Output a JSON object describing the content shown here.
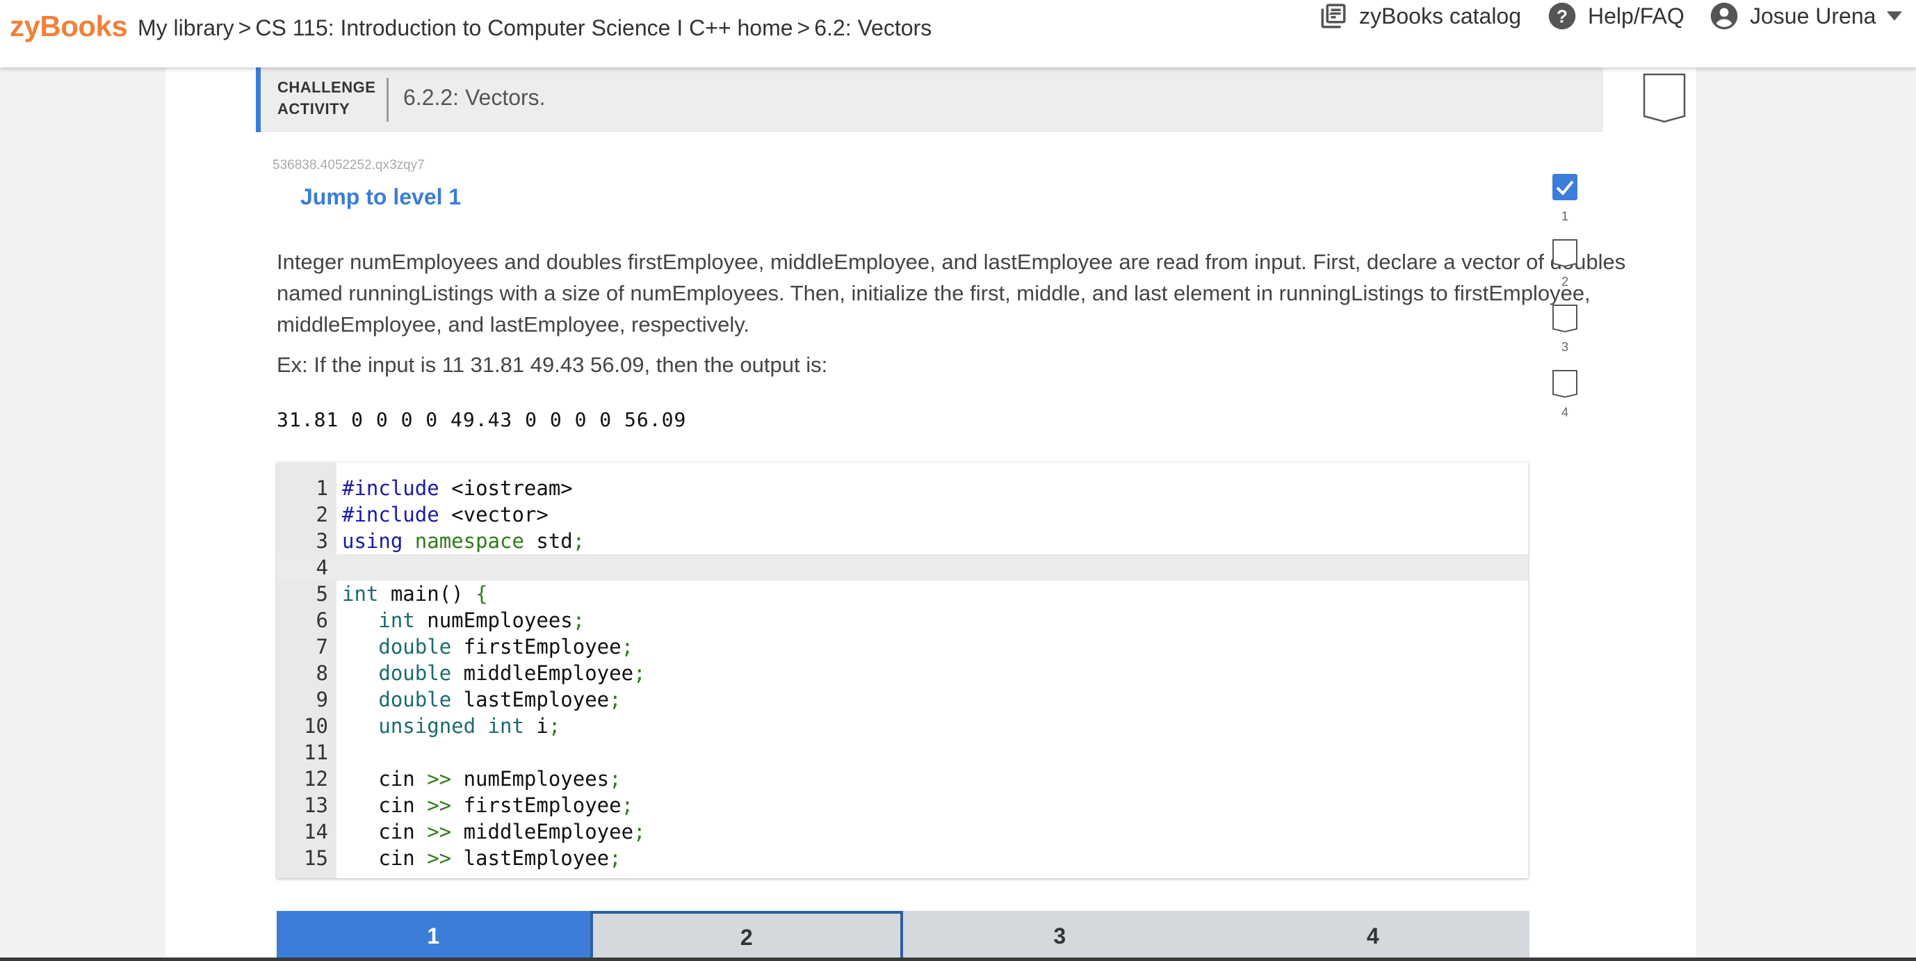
{
  "topbar": {
    "logo": "zyBooks",
    "breadcrumb": [
      "My library",
      "CS 115: Introduction to Computer Science I C++ home",
      "6.2: Vectors"
    ],
    "separator": ">",
    "catalog_label": "zyBooks catalog",
    "help_label": "Help/FAQ",
    "user_name": "Josue Urena"
  },
  "activity": {
    "type_label_line1": "CHALLENGE",
    "type_label_line2": "ACTIVITY",
    "title": "6.2.2: Vectors.",
    "id": "536838.4052252.qx3zqy7",
    "jump_label": "Jump to level 1",
    "prompt": "Integer numEmployees and doubles firstEmployee, middleEmployee, and lastEmployee are read from input. First, declare a vector of doubles named runningListings with a size of numEmployees. Then, initialize the first, middle, and last element in runningListings to firstEmployee, middleEmployee, and lastEmployee, respectively.",
    "example": "Ex: If the input is 11 31.81 49.43 56.09, then the output is:",
    "expected_output": "31.81 0 0 0 0 49.43 0 0 0 0 56.09"
  },
  "code": {
    "active_line": 4,
    "lines": [
      {
        "n": "1",
        "segments": [
          {
            "t": "#include",
            "c": "kw-pre"
          },
          {
            "t": " <iostream>",
            "c": ""
          }
        ]
      },
      {
        "n": "2",
        "segments": [
          {
            "t": "#include",
            "c": "kw-pre"
          },
          {
            "t": " <vector>",
            "c": ""
          }
        ]
      },
      {
        "n": "3",
        "segments": [
          {
            "t": "using",
            "c": "kw-pre"
          },
          {
            "t": " ",
            "c": ""
          },
          {
            "t": "namespace",
            "c": "kw-green"
          },
          {
            "t": " std",
            "c": ""
          },
          {
            "t": ";",
            "c": "punc"
          }
        ]
      },
      {
        "n": "4",
        "segments": []
      },
      {
        "n": "5",
        "segments": [
          {
            "t": "int",
            "c": "kw"
          },
          {
            "t": " main() ",
            "c": ""
          },
          {
            "t": "{",
            "c": "punc"
          }
        ]
      },
      {
        "n": "6",
        "segments": [
          {
            "t": "   ",
            "c": ""
          },
          {
            "t": "int",
            "c": "kw"
          },
          {
            "t": " numEmployees",
            "c": ""
          },
          {
            "t": ";",
            "c": "punc"
          }
        ]
      },
      {
        "n": "7",
        "segments": [
          {
            "t": "   ",
            "c": ""
          },
          {
            "t": "double",
            "c": "kw"
          },
          {
            "t": " firstEmployee",
            "c": ""
          },
          {
            "t": ";",
            "c": "punc"
          }
        ]
      },
      {
        "n": "8",
        "segments": [
          {
            "t": "   ",
            "c": ""
          },
          {
            "t": "double",
            "c": "kw"
          },
          {
            "t": " middleEmployee",
            "c": ""
          },
          {
            "t": ";",
            "c": "punc"
          }
        ]
      },
      {
        "n": "9",
        "segments": [
          {
            "t": "   ",
            "c": ""
          },
          {
            "t": "double",
            "c": "kw"
          },
          {
            "t": " lastEmployee",
            "c": ""
          },
          {
            "t": ";",
            "c": "punc"
          }
        ]
      },
      {
        "n": "10",
        "segments": [
          {
            "t": "   ",
            "c": ""
          },
          {
            "t": "unsigned",
            "c": "kw"
          },
          {
            "t": " ",
            "c": ""
          },
          {
            "t": "int",
            "c": "kw"
          },
          {
            "t": " i",
            "c": ""
          },
          {
            "t": ";",
            "c": "punc"
          }
        ]
      },
      {
        "n": "11",
        "segments": []
      },
      {
        "n": "12",
        "segments": [
          {
            "t": "   cin ",
            "c": ""
          },
          {
            "t": ">>",
            "c": "punc"
          },
          {
            "t": " numEmployees",
            "c": ""
          },
          {
            "t": ";",
            "c": "punc"
          }
        ]
      },
      {
        "n": "13",
        "segments": [
          {
            "t": "   cin ",
            "c": ""
          },
          {
            "t": ">>",
            "c": "punc"
          },
          {
            "t": " firstEmployee",
            "c": ""
          },
          {
            "t": ";",
            "c": "punc"
          }
        ]
      },
      {
        "n": "14",
        "segments": [
          {
            "t": "   cin ",
            "c": ""
          },
          {
            "t": ">>",
            "c": "punc"
          },
          {
            "t": " middleEmployee",
            "c": ""
          },
          {
            "t": ";",
            "c": "punc"
          }
        ]
      },
      {
        "n": "15",
        "segments": [
          {
            "t": "   cin ",
            "c": ""
          },
          {
            "t": ">>",
            "c": "punc"
          },
          {
            "t": " lastEmployee",
            "c": ""
          },
          {
            "t": ";",
            "c": "punc"
          }
        ]
      }
    ]
  },
  "levels": [
    {
      "label": "1",
      "completed": true
    },
    {
      "label": "2",
      "completed": false
    },
    {
      "label": "3",
      "completed": false
    },
    {
      "label": "4",
      "completed": false
    }
  ],
  "tabs": [
    {
      "label": "1",
      "state": "complete"
    },
    {
      "label": "2",
      "state": "current"
    },
    {
      "label": "3",
      "state": "locked"
    },
    {
      "label": "4",
      "state": "locked"
    }
  ],
  "colors": {
    "brand": "#f0813a",
    "accent": "#3b7dd8",
    "tab_current_border": "#2d5f9e",
    "tab_locked": "#d5d9dd"
  }
}
